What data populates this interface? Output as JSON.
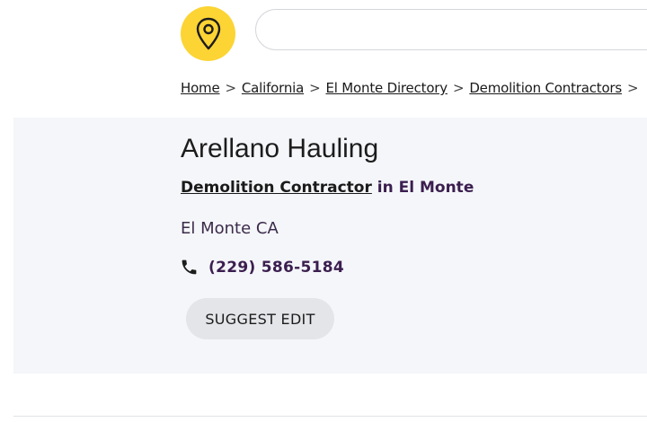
{
  "header": {
    "logo_icon": "map-pin-icon",
    "logo_color": "#fcd434",
    "search": {
      "value": "",
      "placeholder": ""
    }
  },
  "breadcrumb": {
    "items": [
      "Home",
      "California",
      "El Monte Directory",
      "Demolition Contractors"
    ],
    "separator": ">"
  },
  "listing": {
    "name": "Arellano Hauling",
    "category_link": "Demolition Contractor",
    "category_suffix": "in El Monte",
    "location": "El Monte CA",
    "phone_icon": "phone-icon",
    "phone": "(229) 586-5184",
    "suggest_edit_label": "SUGGEST EDIT"
  },
  "colors": {
    "accent_text": "#3b1e4f",
    "panel_background": "#f4f6f9",
    "button_background": "#e3e5e8"
  }
}
